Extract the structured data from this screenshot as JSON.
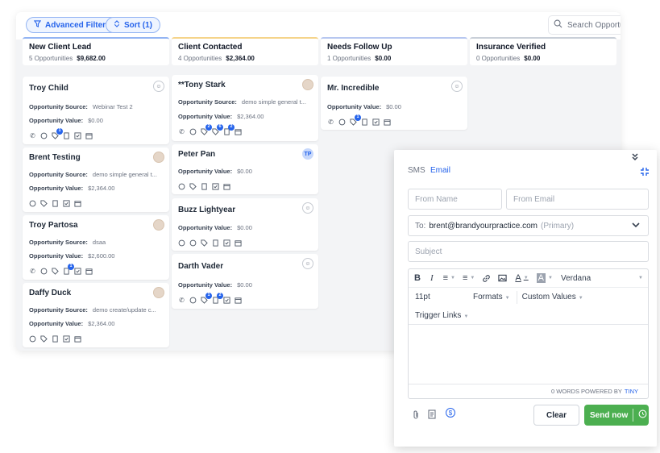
{
  "toolbar": {
    "advanced_filters_label": "Advanced Filters",
    "sort_label": "Sort (1)",
    "search_placeholder": "Search Opportu"
  },
  "columns": [
    {
      "title": "New Client Lead",
      "count": "5 Opportunities",
      "total": "$9,682.00",
      "accent": "#93b4f3"
    },
    {
      "title": "Client Contacted",
      "count": "4 Opportunities",
      "total": "$2,364.00",
      "accent": "#f5d48a"
    },
    {
      "title": "Needs Follow Up",
      "count": "1 Opportunities",
      "total": "$0.00",
      "accent": "#b7c7f0"
    },
    {
      "title": "Insurance Verified",
      "count": "0 Opportunities",
      "total": "$0.00",
      "accent": "#c9cfd8"
    }
  ],
  "labels": {
    "source": "Opportunity Source:",
    "value": "Opportunity Value:"
  },
  "cards": {
    "c1": {
      "name": "Troy Child",
      "source": "Webinar Test 2",
      "value": "$0.00",
      "badge": "1"
    },
    "c2": {
      "name": "Brent Testing",
      "source": "demo simple general t...",
      "value": "$2,364.00"
    },
    "c3": {
      "name": "Troy Partosa",
      "source": "dsaa",
      "value": "$2,600.00",
      "badge": "1"
    },
    "c4": {
      "name": "Daffy Duck",
      "source": "demo create/update c...",
      "value": "$2,364.00"
    },
    "c5": {
      "name": "**Tony Stark",
      "source": "demo simple general t...",
      "value": "$2,364.00",
      "badge1": "2",
      "badge2": "6",
      "badge3": "2"
    },
    "c6": {
      "name": "Peter Pan",
      "value": "$0.00",
      "avatar": "TP"
    },
    "c7": {
      "name": "Buzz Lightyear",
      "value": "$0.00"
    },
    "c8": {
      "name": "Darth Vader",
      "value": "$0.00",
      "badge1": "1",
      "badge2": "2"
    },
    "c9": {
      "name": "Mr. Incredible",
      "value": "$0.00",
      "badge": "1"
    }
  },
  "composer": {
    "tab_sms": "SMS",
    "tab_email": "Email",
    "from_name_placeholder": "From Name",
    "from_email_placeholder": "From Email",
    "to_label": "To:",
    "to_value": "brent@brandyourpractice.com",
    "to_tag": "(Primary)",
    "subject_placeholder": "Subject",
    "font_name": "Verdana",
    "font_size": "11pt",
    "formats": "Formats",
    "custom_values": "Custom Values",
    "trigger_links": "Trigger Links",
    "word_count": "0 WORDS POWERED BY",
    "tiny": "TINY",
    "clear_label": "Clear",
    "send_label": "Send now"
  },
  "colors": {
    "accent": "#2563eb",
    "send": "#4caf50"
  }
}
